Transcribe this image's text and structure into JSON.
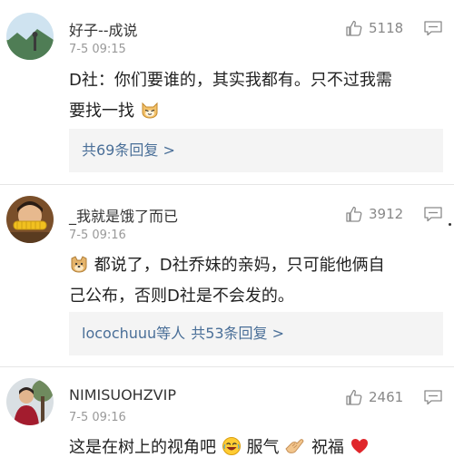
{
  "comments": [
    {
      "username": "好子--成说",
      "time": "7-5 09:15",
      "likes": "5118",
      "text_1": "D社：你们要谁的，其实我都有。只不过我需",
      "text_2": "要找一找",
      "replies": {
        "prefix": "",
        "label": "共69条回复 >"
      },
      "avatar_icon": "landscape-avatar",
      "emoji_icon": "cat-face-emoji"
    },
    {
      "username": "_我就是饿了而已",
      "time": "7-5 09:16",
      "likes": "3912",
      "text_1": "都说了，D社乔妹的亲妈，只可能他俩自",
      "text_2": "己公布，否则D社是不会发的。",
      "replies": {
        "prefix": "locochuuu等人",
        "label": "共53条回复 >"
      },
      "avatar_icon": "person-eating-corn-avatar",
      "emoji_icon": "doge-emoji"
    },
    {
      "username": "NIMISUOHZVIP",
      "time": "7-5 09:16",
      "likes": "2461",
      "text_1": "这是在树上的视角吧",
      "text_2": "服气",
      "text_3": "祝福",
      "avatar_icon": "person-by-tree-avatar",
      "emoji_icons": [
        "laughing-crying-emoji",
        "fist-bump-emoji",
        "red-heart-emoji"
      ]
    }
  ],
  "icons": {
    "like": "thumbs-up-icon",
    "reply": "comment-bubble-icon"
  },
  "colors": {
    "link": "#4a6f98",
    "meta": "#999999",
    "reply_bg": "#f4f4f4",
    "heart": "#e0262b"
  }
}
